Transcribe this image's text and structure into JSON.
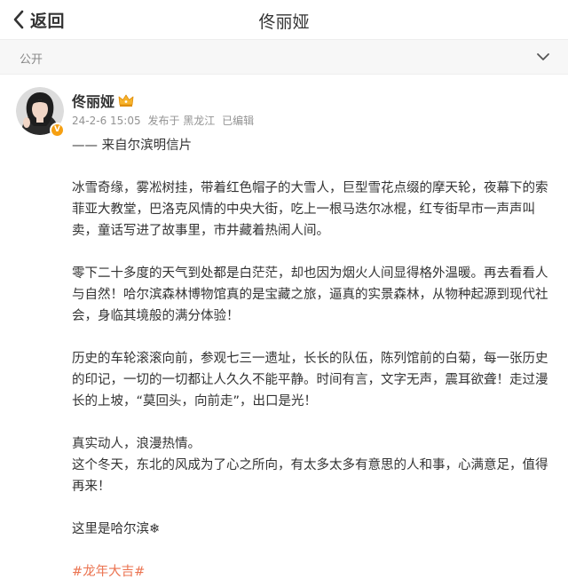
{
  "nav": {
    "back_label": "返回",
    "title": "佟丽娅"
  },
  "visibility": {
    "label": "公开"
  },
  "post": {
    "author": "佟丽娅",
    "date": "24-2-6 15:05",
    "location": "发布于 黑龙江",
    "edited": "已编辑",
    "paragraphs": [
      "—— 来自尔滨明信片",
      "冰雪奇缘，雾凇树挂，带着红色帽子的大雪人，巨型雪花点缀的摩天轮，夜幕下的索菲亚大教堂，巴洛克风情的中央大街，吃上一根马迭尔冰棍，红专街早市一声声叫卖，童话写进了故事里，市井藏着热闹人间。",
      "零下二十多度的天气到处都是白茫茫，却也因为烟火人间显得格外温暖。再去看看人与自然！哈尔滨森林博物馆真的是宝藏之旅，逼真的实景森林，从物种起源到现代社会，身临其境般的满分体验！",
      "历史的车轮滚滚向前，参观七三一遗址，长长的队伍，陈列馆前的白菊，每一张历史的印记，一切的一切都让人久久不能平静。时间有言，文字无声，震耳欲聋！走过漫长的上坡，“莫回头，向前走”，出口是光！",
      "真实动人，浪漫热情。",
      "这个冬天，东北的风成为了心之所向，有太多太多有意思的人和事，心满意足，值得再来！",
      "这里是哈尔滨❄",
      "#龙年大吉#"
    ]
  },
  "colors": {
    "accent": "#eb7350",
    "meta_gray": "#939393",
    "vip_orange": "#f6a012"
  },
  "icons": [
    "back-chevron-icon",
    "chevron-down-icon",
    "crown-icon",
    "vip-badge-icon"
  ]
}
